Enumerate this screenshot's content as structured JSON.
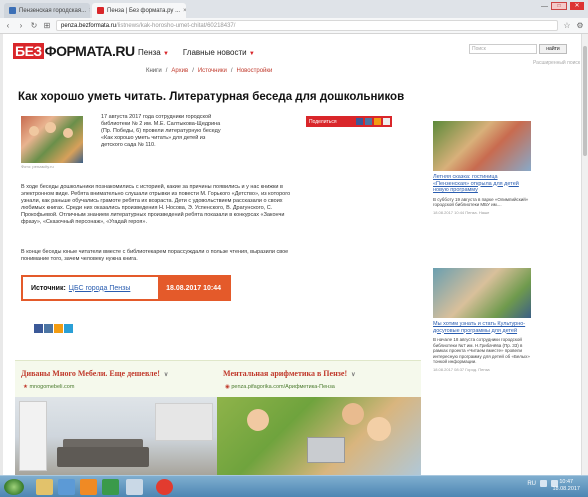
{
  "browser": {
    "tabs": [
      {
        "title": "Пензенская городская...",
        "active": false
      },
      {
        "title": "Пенза | Без формата.ру ...",
        "active": true
      }
    ],
    "url_host": "penza.bezformata.ru",
    "url_path": "/listnews/kak-horosho-umet-chitat/60218437/",
    "minimize": "—",
    "restore": "□",
    "close": "✕"
  },
  "site": {
    "logo_mark": "БЕЗ",
    "logo_rest": "ФОРМАТА.RU",
    "city": "Пенза",
    "main_news": "Главные новости",
    "search_placeholder": "Поиск",
    "search_button": "найти",
    "advanced_search": "Расширенный поиск",
    "subnav": [
      "Книги",
      "/",
      "Архив",
      "/",
      "Источники",
      "/",
      "Новостройки"
    ]
  },
  "article": {
    "title": "Как хорошо уметь читать. Литературная беседа для дошкольников",
    "photo_caption": "Фото: penzacity.ru",
    "lead": "17 августа 2017 года сотрудники городской библиотеки № 2 им. М.Е. Салтыкова-Щедрина (Пр. Победы, 6) провели литературную беседу «Как хорошо уметь читать» для детей из детского сада № 110.",
    "body1": "В ходе беседы дошкольники познакомились с историей, какие за причины появились и у нас книжки в электронном виде. Ребята внимательно слушали отрывки из повести М. Горького «Детство», из которого узнали, как раньше обучались грамоте ребята их возраста. Дети с удовольствием рассказали о своих любимых книгах. Среди них оказались произведения Н. Носова, Э. Успенского, В. Драгунского, С. Прокофьевой. Отличным знанием литературных произведений ребята показали в конкурсах «Закончи фразу», «Сказочный персонаж», «Угадай героя».",
    "body2": "В конце беседы юные читатели вместе с библиотекарем порассуждали о пользе чтения, выразили свое понимание того, зачем человеку нужна книга.",
    "source_label": "Источник:",
    "source_value": "ЦБС города Пензы",
    "source_date": "18.08.2017  10:44",
    "share_label": "Поделиться"
  },
  "ads": [
    {
      "title": "Диваны Много Мебели. Еще дешевле!",
      "source": "mnogomebeli.com"
    },
    {
      "title": "Ментальная арифметика в Пензе!",
      "source": "penza.pifagorika.com/Арифметика-Пенза"
    }
  ],
  "sidebar": [
    {
      "headline": "Летняя сказка: гостиница «Пензенская» открыла для детей новую программу",
      "text": "В субботу 19 августа в парке «Олимпийский» городской библиотеки МБУ им....",
      "meta": "18.08.2017 10:44  Пенза. Наше"
    },
    {
      "headline": "Мы хотим узнать и стать Культурно-досуговые программы для детей",
      "text": "В начале 18 августа сотрудники городской библиотеки №7 им. Н.Грибачёва (Пр. 33) в рамках проекта «Читаем вместе» провели интересную программу для детей об «Белых» тонкой информации.",
      "meta": "18.08.2017 08:37  Город. Пенза"
    }
  ],
  "taskbar": {
    "lang": "RU",
    "time": "10:47",
    "date": "18.08.2017"
  }
}
